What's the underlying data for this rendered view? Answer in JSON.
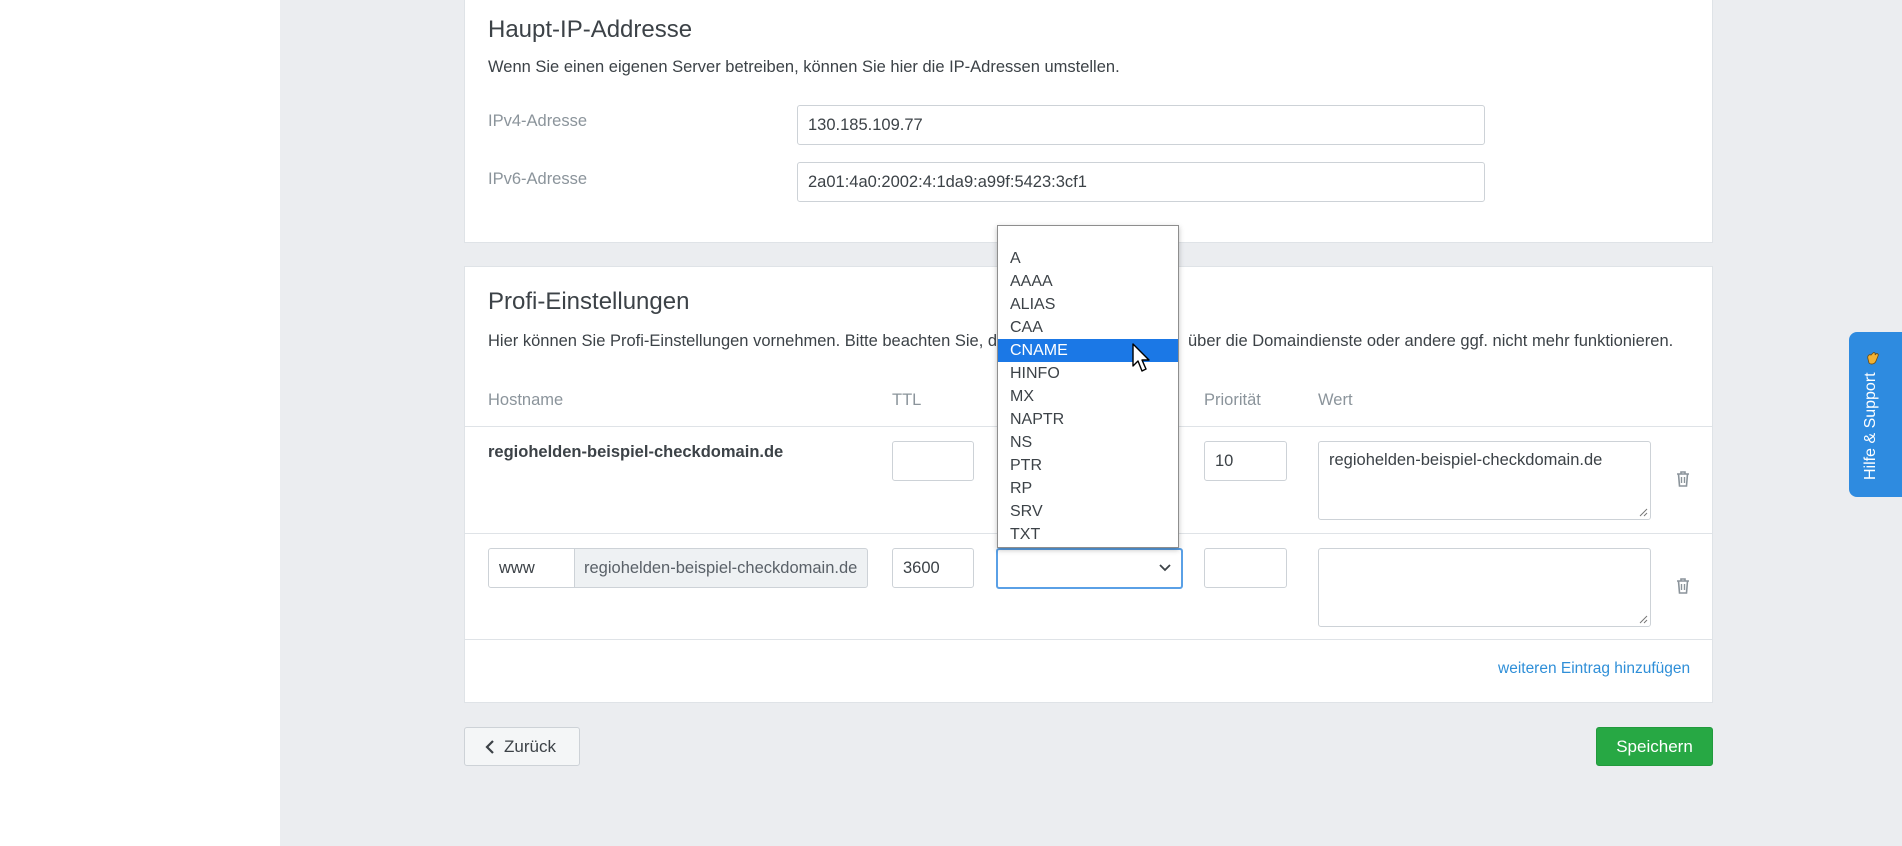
{
  "ip_section": {
    "title": "Haupt-IP-Addresse",
    "description": "Wenn Sie einen eigenen Server betreiben, können Sie hier die IP-Adressen umstellen.",
    "ipv4_label": "IPv4-Adresse",
    "ipv4_value": "130.185.109.77",
    "ipv6_label": "IPv6-Adresse",
    "ipv6_value": "2a01:4a0:2002:4:1da9:a99f:5423:3cf1"
  },
  "profi_section": {
    "title": "Profi-Einstellungen",
    "description_before": "Hier können Sie Profi-Einstellungen vornehmen. Bitte beachten Sie, da",
    "description_after": "über die Domaindienste oder andere ggf. nicht mehr funktionieren.",
    "columns": {
      "hostname": "Hostname",
      "ttl": "TTL",
      "prioritaet": "Priorität",
      "wert": "Wert"
    },
    "rows": [
      {
        "hostname": "regiohelden-beispiel-checkdomain.de",
        "ttl": "",
        "prioritaet": "10",
        "wert": "regiohelden-beispiel-checkdomain.de"
      },
      {
        "subdomain": "www",
        "domain_suffix": "regiohelden-beispiel-checkdomain.de",
        "ttl": "3600",
        "type": "",
        "prioritaet": "",
        "wert": ""
      }
    ],
    "add_link": "weiteren Eintrag hinzufügen"
  },
  "type_dropdown": {
    "options": [
      "",
      "A",
      "AAAA",
      "ALIAS",
      "CAA",
      "CNAME",
      "HINFO",
      "MX",
      "NAPTR",
      "NS",
      "PTR",
      "RP",
      "SRV",
      "TXT"
    ],
    "highlighted": "CNAME"
  },
  "buttons": {
    "back": "Zurück",
    "save": "Speichern"
  },
  "help_tab": {
    "label": "Hilfe & Support"
  },
  "colors": {
    "page_background": "#ebedf0",
    "primary_blue": "#2e8be0",
    "save_green": "#27a844",
    "highlight_blue": "#1b78e6"
  }
}
